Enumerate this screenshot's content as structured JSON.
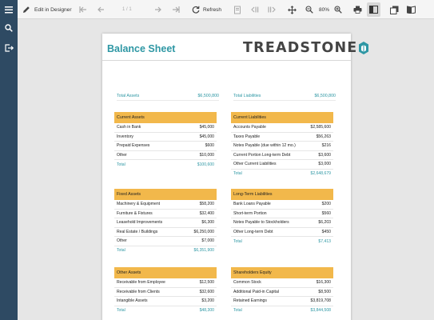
{
  "toolbar": {
    "edit_label": "Edit in Designer",
    "page_indicator": "1 / 1",
    "refresh_label": "Refresh",
    "zoom": "80%"
  },
  "report": {
    "title": "Balance Sheet",
    "logo_text": "TREADSTONE",
    "total_assets": {
      "label": "Total Assets",
      "value": "$6,500,800"
    },
    "total_liabilities": {
      "label": "Total Liabilities",
      "value": "$6,500,800"
    },
    "current_assets": {
      "title": "Current Assets",
      "rows": [
        {
          "label": "Cash in Bank",
          "value": "$45,000"
        },
        {
          "label": "Inventory",
          "value": "$45,000"
        },
        {
          "label": "Prepaid Expenses",
          "value": "$600"
        },
        {
          "label": "Other",
          "value": "$10,000"
        }
      ],
      "total": {
        "label": "Total",
        "value": "$100,600"
      }
    },
    "current_liabilities": {
      "title": "Current Liabilities",
      "rows": [
        {
          "label": "Accounts Payable",
          "value": "$2,585,600"
        },
        {
          "label": "Taxes Payable",
          "value": "$56,263"
        },
        {
          "label": "Notes Payable (due within 12 mo.)",
          "value": "$216"
        },
        {
          "label": "Current Portion Long-term Debt",
          "value": "$3,600"
        },
        {
          "label": "Other Current Liabilities",
          "value": "$3,000"
        }
      ],
      "total": {
        "label": "Total",
        "value": "$2,648,679"
      }
    },
    "fixed_assets": {
      "title": "Fixed Assets",
      "rows": [
        {
          "label": "Machinery & Equipment",
          "value": "$58,200"
        },
        {
          "label": "Furniture & Fixtures",
          "value": "$32,400"
        },
        {
          "label": "Leasehold Improvements",
          "value": "$6,300"
        },
        {
          "label": "Real Estate / Buildings",
          "value": "$6,250,000"
        },
        {
          "label": "Other",
          "value": "$7,000"
        }
      ],
      "total": {
        "label": "Total",
        "value": "$6,351,900"
      }
    },
    "long_term_liabilities": {
      "title": "Long-Term Liabilities",
      "rows": [
        {
          "label": "Bank Loans Payable",
          "value": "$200"
        },
        {
          "label": "Short-term Portion",
          "value": "$560"
        },
        {
          "label": "Notes Payable to Stockholders",
          "value": "$6,203"
        },
        {
          "label": "Other Long-term Debt",
          "value": "$450"
        }
      ],
      "total": {
        "label": "Total",
        "value": "$7,413"
      }
    },
    "other_assets": {
      "title": "Other Assets",
      "rows": [
        {
          "label": "Receivable from Employee",
          "value": "$12,500"
        },
        {
          "label": "Receivable from Clients",
          "value": "$32,600"
        },
        {
          "label": "Intangible Assets",
          "value": "$3,200"
        }
      ],
      "total": {
        "label": "Total",
        "value": "$48,300"
      }
    },
    "shareholders_equity": {
      "title": "Shareholders Equity",
      "rows": [
        {
          "label": "Common Stock",
          "value": "$16,300"
        },
        {
          "label": "Additional Paid-in Capital",
          "value": "$8,500"
        },
        {
          "label": "Retained Earnings",
          "value": "$3,819,708"
        }
      ],
      "total": {
        "label": "Total",
        "value": "$3,844,508"
      }
    }
  },
  "colors": {
    "sidebar": "#2e4a63",
    "accent": "#2e97a4",
    "section_header": "#f2b84b"
  }
}
